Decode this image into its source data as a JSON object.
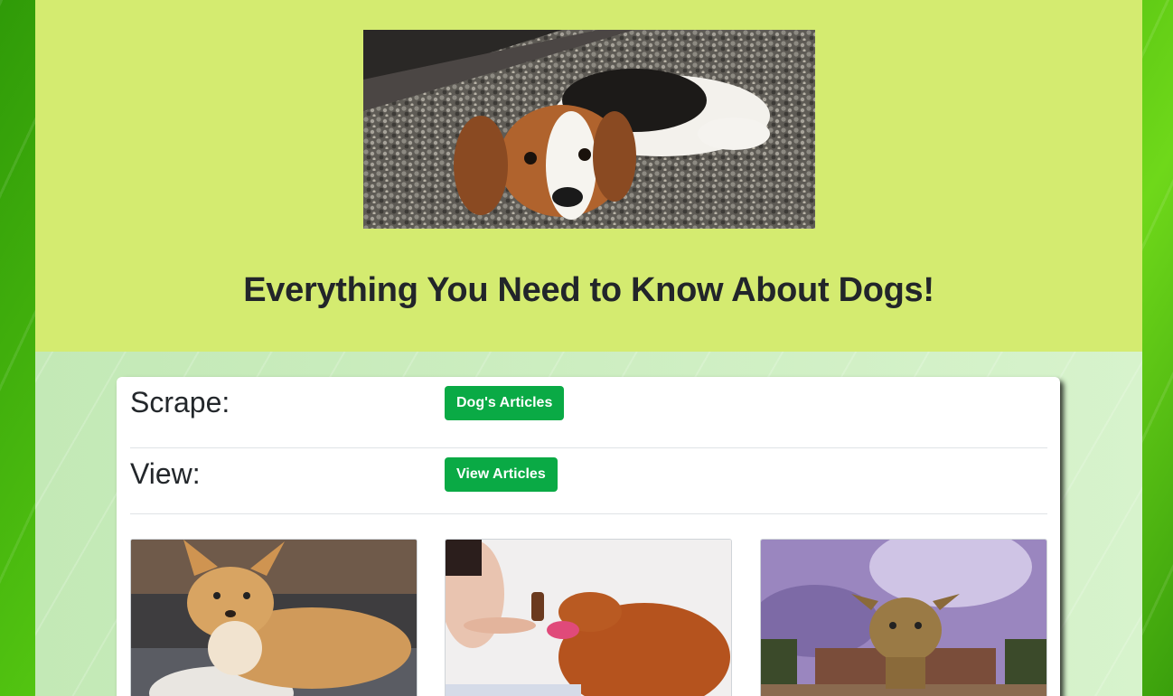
{
  "header": {
    "title": "Everything You Need to Know About Dogs!",
    "hero_image": "beagle-puppy-image"
  },
  "controls": {
    "scrape_label": "Scrape:",
    "scrape_button": "Dog's Articles",
    "view_label": "View:",
    "view_button": "View Articles"
  },
  "gallery": [
    {
      "image": "chihuahua-image"
    },
    {
      "image": "poodle-grooming-image"
    },
    {
      "image": "pug-mix-on-rock-image"
    }
  ],
  "colors": {
    "button": "#0aaa45",
    "header_bg": "#d4eb70"
  }
}
